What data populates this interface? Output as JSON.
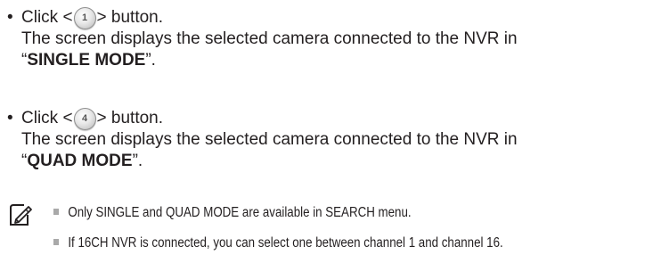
{
  "steps": [
    {
      "bullet": "•",
      "click_prefix": "Click <",
      "button_label": "1",
      "click_suffix": "> button.",
      "description": "The screen displays the selected camera connected to the NVR in",
      "mode_open_quote": "“",
      "mode": "SINGLE MODE",
      "mode_close_quote": "”."
    },
    {
      "bullet": "•",
      "click_prefix": "Click <",
      "button_label": "4",
      "click_suffix": "> button.",
      "description": "The screen displays the selected camera connected to the NVR in",
      "mode_open_quote": "“",
      "mode": "QUAD MODE",
      "mode_close_quote": "”."
    }
  ],
  "note": {
    "icon": "note-pencil-icon",
    "items": [
      "Only SINGLE and QUAD MODE are available in SEARCH menu.",
      "If 16CH NVR is connected, you can select one between channel 1 and channel 16."
    ]
  }
}
